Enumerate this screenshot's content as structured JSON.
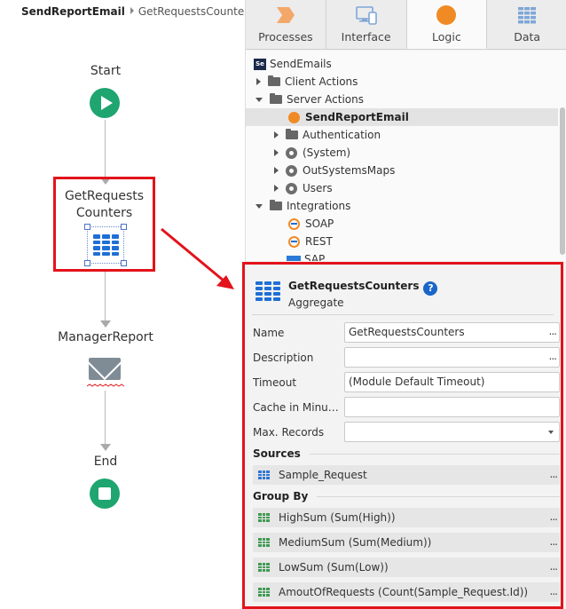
{
  "breadcrumb": {
    "current": "SendReportEmail",
    "child": "GetRequestsCounters"
  },
  "flow": {
    "start_label": "Start",
    "aggregate_label_line1": "GetRequests",
    "aggregate_label_line2": "Counters",
    "email_label": "ManagerReport",
    "end_label": "End"
  },
  "tabs": [
    {
      "label": "Processes",
      "icon": "processes-icon"
    },
    {
      "label": "Interface",
      "icon": "interface-icon"
    },
    {
      "label": "Logic",
      "icon": "logic-icon",
      "active": true
    },
    {
      "label": "Data",
      "icon": "data-icon"
    }
  ],
  "tree": {
    "module": "SendEmails",
    "module_badge": "Se",
    "client_actions": "Client Actions",
    "server_actions": "Server Actions",
    "selected_action": "SendReportEmail",
    "authentication": "Authentication",
    "system": "(System)",
    "maps": "OutSystemsMaps",
    "users": "Users",
    "integrations": "Integrations",
    "soap": "SOAP",
    "rest": "REST",
    "sap": "SAP"
  },
  "properties": {
    "title": "GetRequestsCounters",
    "subtitle": "Aggregate",
    "help": "?",
    "ellipsis": "...",
    "fields": {
      "name_label": "Name",
      "name_value": "GetRequestsCounters",
      "description_label": "Description",
      "description_value": "",
      "timeout_label": "Timeout",
      "timeout_value": "(Module Default Timeout)",
      "cache_label": "Cache in Minut...",
      "cache_value": "",
      "max_records_label": "Max. Records",
      "max_records_value": ""
    },
    "sources_header": "Sources",
    "sources": [
      "Sample_Request"
    ],
    "group_by_header": "Group By",
    "group_by": [
      "HighSum (Sum(High))",
      "MediumSum (Sum(Medium))",
      "LowSum (Sum(Low))",
      "AmoutOfRequests (Count(Sample_Request.Id))"
    ]
  },
  "colors": {
    "accent_green": "#1fa570",
    "annotation_red": "#e3131b",
    "aggregate_blue": "#1f6fd6",
    "logic_orange": "#f08a24"
  }
}
